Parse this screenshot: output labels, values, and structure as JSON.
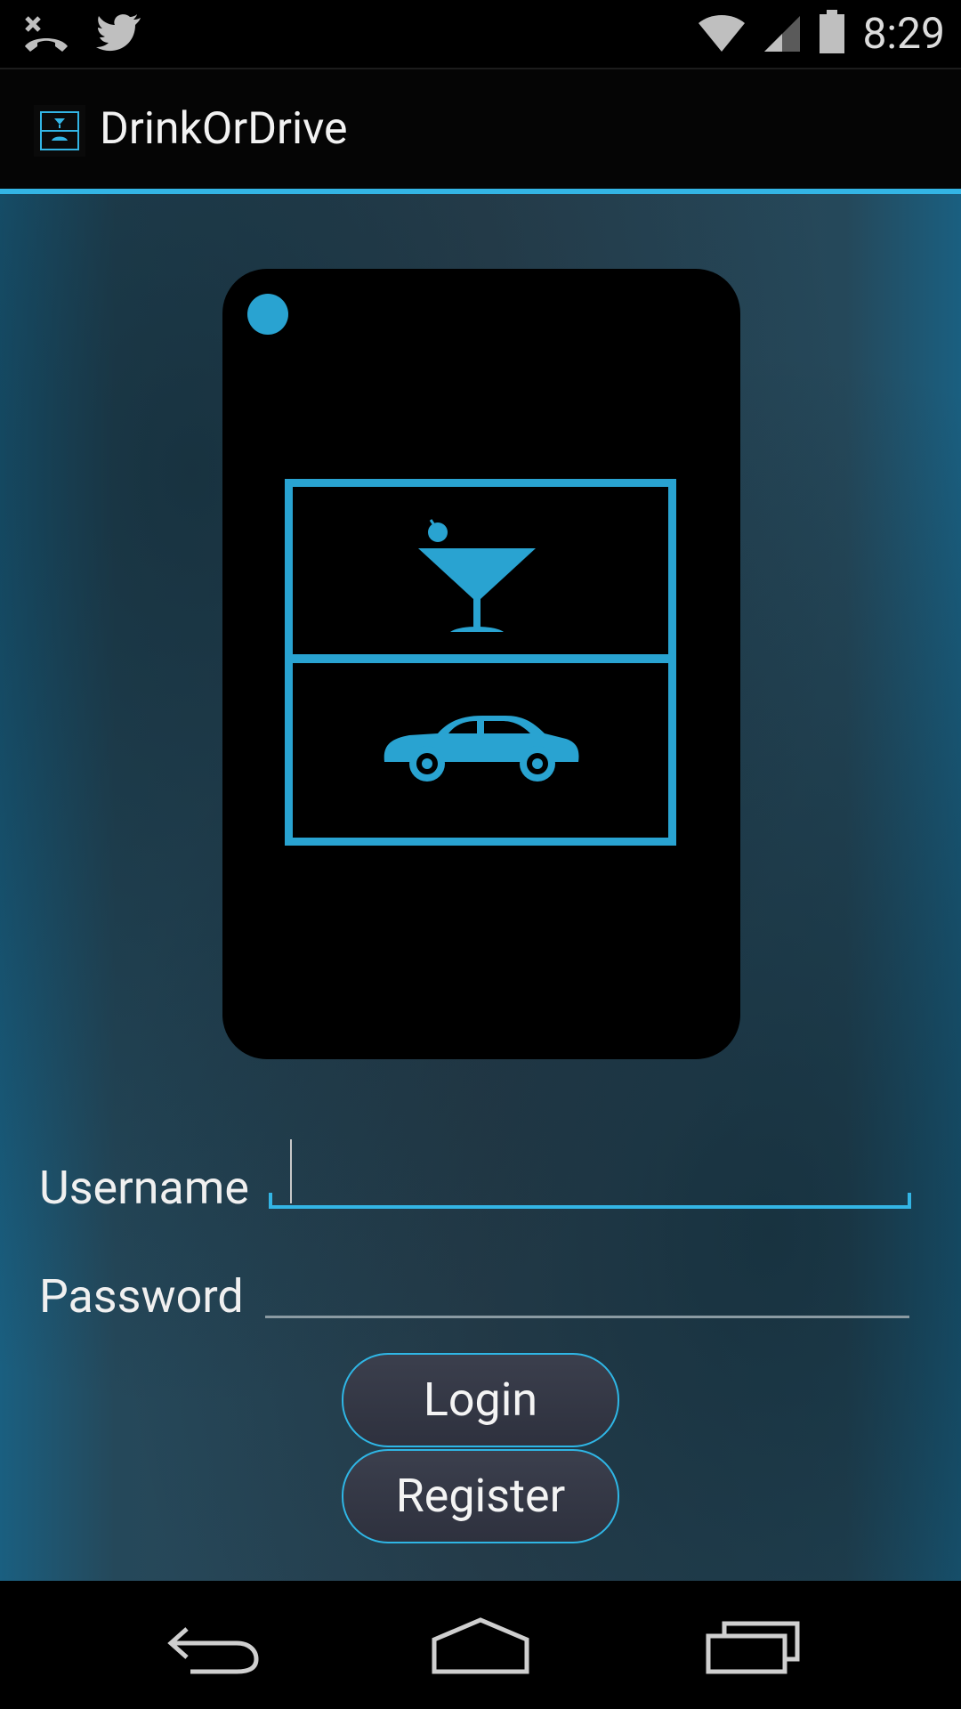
{
  "status_bar": {
    "time": "8:29",
    "left_icons": [
      "missed-call-icon",
      "twitter-icon"
    ],
    "right_icons": [
      "wifi-icon",
      "signal-icon",
      "battery-icon"
    ]
  },
  "app_bar": {
    "title": "DrinkOrDrive"
  },
  "login_form": {
    "username_label": "Username",
    "username_value": "",
    "password_label": "Password",
    "password_value": ""
  },
  "buttons": {
    "login_label": "Login",
    "register_label": "Register"
  },
  "nav_bar": {
    "items": [
      "back-icon",
      "home-icon",
      "recents-icon"
    ]
  },
  "colors": {
    "accent": "#33b5e5",
    "logo_blue": "#29a3d1",
    "background": "#2b4352"
  }
}
